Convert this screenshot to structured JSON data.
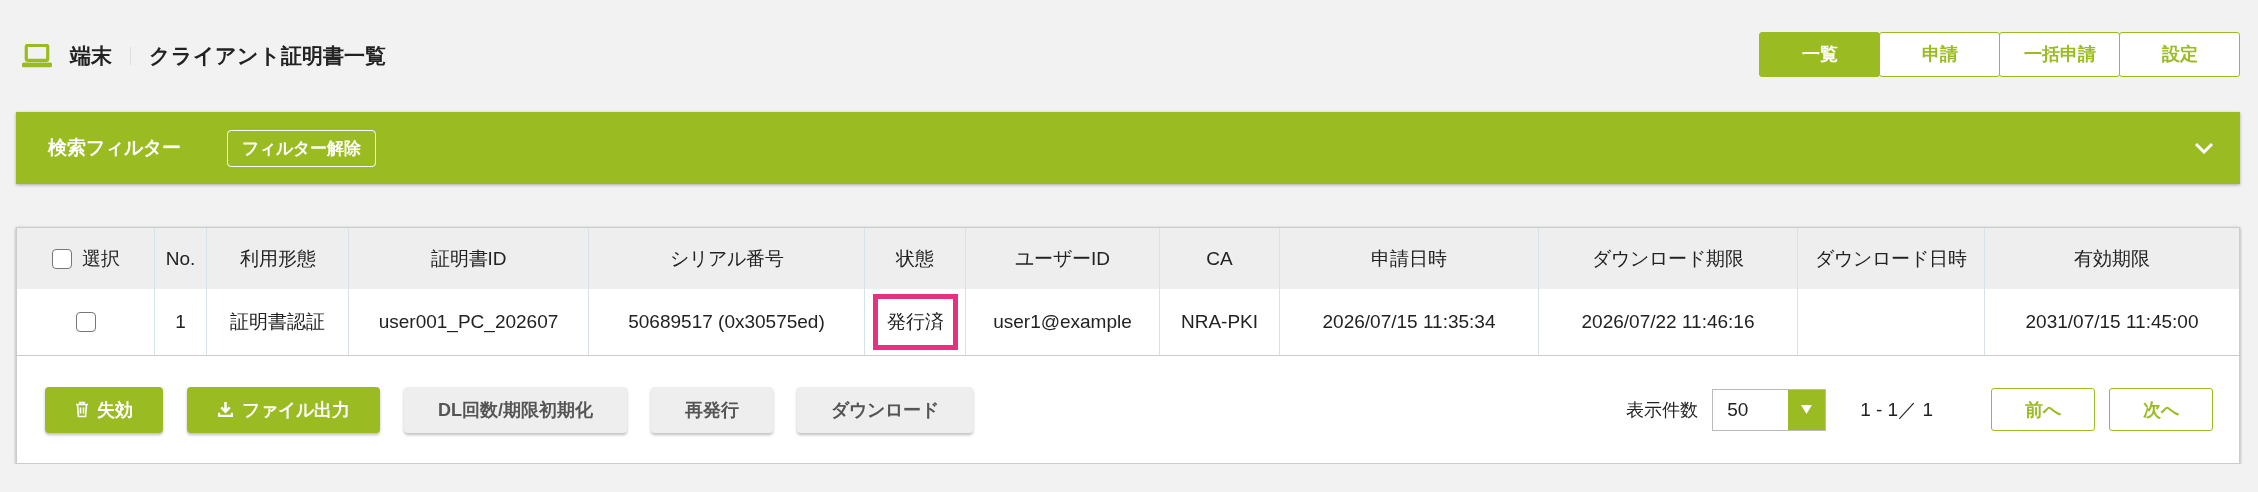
{
  "header": {
    "section": "端末",
    "title": "クライアント証明書一覧"
  },
  "tabs": [
    {
      "label": "一覧",
      "selected": true
    },
    {
      "label": "申請",
      "selected": false
    },
    {
      "label": "一括申請",
      "selected": false
    },
    {
      "label": "設定",
      "selected": false
    }
  ],
  "filter": {
    "title": "検索フィルター",
    "clear_button": "フィルター解除",
    "expanded": false
  },
  "table": {
    "select_all": {
      "label": "選択",
      "checked": false
    },
    "columns": [
      "No.",
      "利用形態",
      "証明書ID",
      "シリアル番号",
      "状態",
      "ユーザーID",
      "CA",
      "申請日時",
      "ダウンロード期限",
      "ダウンロード日時",
      "有効期限"
    ],
    "rows": [
      {
        "checked": false,
        "no": "1",
        "usage": "証明書認証",
        "certificate_id": "user001_PC_202607",
        "serial": "50689517 (0x30575ed)",
        "status": {
          "text": "発行済",
          "highlighted": true
        },
        "user_id": "user1@example",
        "ca": "NRA-PKI",
        "applied_at": "2026/07/15 11:35:34",
        "download_deadline": "2026/07/22 11:46:16",
        "expires": "2031/07/15 11:45:00"
      }
    ]
  },
  "actions": [
    {
      "label": "失効",
      "kind": "revoke"
    },
    {
      "label": "ファイル出力",
      "kind": "export"
    },
    {
      "label": "DL回数/期限初期化",
      "kind": "secondary"
    },
    {
      "label": "再発行",
      "kind": "secondary"
    },
    {
      "label": "ダウンロード",
      "kind": "secondary"
    }
  ],
  "pagination": {
    "per_page_label": "表示件数",
    "per_page": "50",
    "range": "1 - 1／ 1",
    "prev": "前へ",
    "next": "次へ"
  }
}
